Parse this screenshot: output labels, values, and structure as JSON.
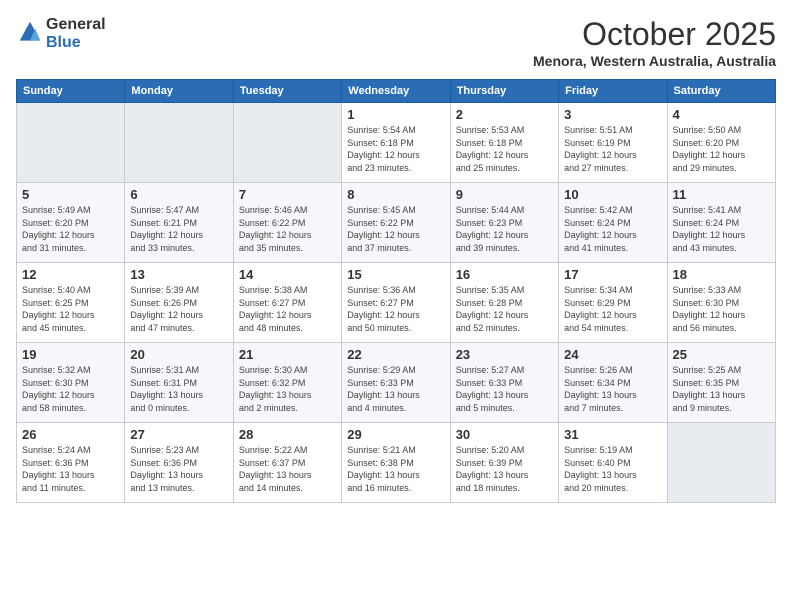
{
  "header": {
    "logo_line1": "General",
    "logo_line2": "Blue",
    "month_title": "October 2025",
    "location": "Menora, Western Australia, Australia"
  },
  "weekdays": [
    "Sunday",
    "Monday",
    "Tuesday",
    "Wednesday",
    "Thursday",
    "Friday",
    "Saturday"
  ],
  "weeks": [
    [
      {
        "day": "",
        "info": ""
      },
      {
        "day": "",
        "info": ""
      },
      {
        "day": "",
        "info": ""
      },
      {
        "day": "1",
        "info": "Sunrise: 5:54 AM\nSunset: 6:18 PM\nDaylight: 12 hours\nand 23 minutes."
      },
      {
        "day": "2",
        "info": "Sunrise: 5:53 AM\nSunset: 6:18 PM\nDaylight: 12 hours\nand 25 minutes."
      },
      {
        "day": "3",
        "info": "Sunrise: 5:51 AM\nSunset: 6:19 PM\nDaylight: 12 hours\nand 27 minutes."
      },
      {
        "day": "4",
        "info": "Sunrise: 5:50 AM\nSunset: 6:20 PM\nDaylight: 12 hours\nand 29 minutes."
      }
    ],
    [
      {
        "day": "5",
        "info": "Sunrise: 5:49 AM\nSunset: 6:20 PM\nDaylight: 12 hours\nand 31 minutes."
      },
      {
        "day": "6",
        "info": "Sunrise: 5:47 AM\nSunset: 6:21 PM\nDaylight: 12 hours\nand 33 minutes."
      },
      {
        "day": "7",
        "info": "Sunrise: 5:46 AM\nSunset: 6:22 PM\nDaylight: 12 hours\nand 35 minutes."
      },
      {
        "day": "8",
        "info": "Sunrise: 5:45 AM\nSunset: 6:22 PM\nDaylight: 12 hours\nand 37 minutes."
      },
      {
        "day": "9",
        "info": "Sunrise: 5:44 AM\nSunset: 6:23 PM\nDaylight: 12 hours\nand 39 minutes."
      },
      {
        "day": "10",
        "info": "Sunrise: 5:42 AM\nSunset: 6:24 PM\nDaylight: 12 hours\nand 41 minutes."
      },
      {
        "day": "11",
        "info": "Sunrise: 5:41 AM\nSunset: 6:24 PM\nDaylight: 12 hours\nand 43 minutes."
      }
    ],
    [
      {
        "day": "12",
        "info": "Sunrise: 5:40 AM\nSunset: 6:25 PM\nDaylight: 12 hours\nand 45 minutes."
      },
      {
        "day": "13",
        "info": "Sunrise: 5:39 AM\nSunset: 6:26 PM\nDaylight: 12 hours\nand 47 minutes."
      },
      {
        "day": "14",
        "info": "Sunrise: 5:38 AM\nSunset: 6:27 PM\nDaylight: 12 hours\nand 48 minutes."
      },
      {
        "day": "15",
        "info": "Sunrise: 5:36 AM\nSunset: 6:27 PM\nDaylight: 12 hours\nand 50 minutes."
      },
      {
        "day": "16",
        "info": "Sunrise: 5:35 AM\nSunset: 6:28 PM\nDaylight: 12 hours\nand 52 minutes."
      },
      {
        "day": "17",
        "info": "Sunrise: 5:34 AM\nSunset: 6:29 PM\nDaylight: 12 hours\nand 54 minutes."
      },
      {
        "day": "18",
        "info": "Sunrise: 5:33 AM\nSunset: 6:30 PM\nDaylight: 12 hours\nand 56 minutes."
      }
    ],
    [
      {
        "day": "19",
        "info": "Sunrise: 5:32 AM\nSunset: 6:30 PM\nDaylight: 12 hours\nand 58 minutes."
      },
      {
        "day": "20",
        "info": "Sunrise: 5:31 AM\nSunset: 6:31 PM\nDaylight: 13 hours\nand 0 minutes."
      },
      {
        "day": "21",
        "info": "Sunrise: 5:30 AM\nSunset: 6:32 PM\nDaylight: 13 hours\nand 2 minutes."
      },
      {
        "day": "22",
        "info": "Sunrise: 5:29 AM\nSunset: 6:33 PM\nDaylight: 13 hours\nand 4 minutes."
      },
      {
        "day": "23",
        "info": "Sunrise: 5:27 AM\nSunset: 6:33 PM\nDaylight: 13 hours\nand 5 minutes."
      },
      {
        "day": "24",
        "info": "Sunrise: 5:26 AM\nSunset: 6:34 PM\nDaylight: 13 hours\nand 7 minutes."
      },
      {
        "day": "25",
        "info": "Sunrise: 5:25 AM\nSunset: 6:35 PM\nDaylight: 13 hours\nand 9 minutes."
      }
    ],
    [
      {
        "day": "26",
        "info": "Sunrise: 5:24 AM\nSunset: 6:36 PM\nDaylight: 13 hours\nand 11 minutes."
      },
      {
        "day": "27",
        "info": "Sunrise: 5:23 AM\nSunset: 6:36 PM\nDaylight: 13 hours\nand 13 minutes."
      },
      {
        "day": "28",
        "info": "Sunrise: 5:22 AM\nSunset: 6:37 PM\nDaylight: 13 hours\nand 14 minutes."
      },
      {
        "day": "29",
        "info": "Sunrise: 5:21 AM\nSunset: 6:38 PM\nDaylight: 13 hours\nand 16 minutes."
      },
      {
        "day": "30",
        "info": "Sunrise: 5:20 AM\nSunset: 6:39 PM\nDaylight: 13 hours\nand 18 minutes."
      },
      {
        "day": "31",
        "info": "Sunrise: 5:19 AM\nSunset: 6:40 PM\nDaylight: 13 hours\nand 20 minutes."
      },
      {
        "day": "",
        "info": ""
      }
    ]
  ]
}
